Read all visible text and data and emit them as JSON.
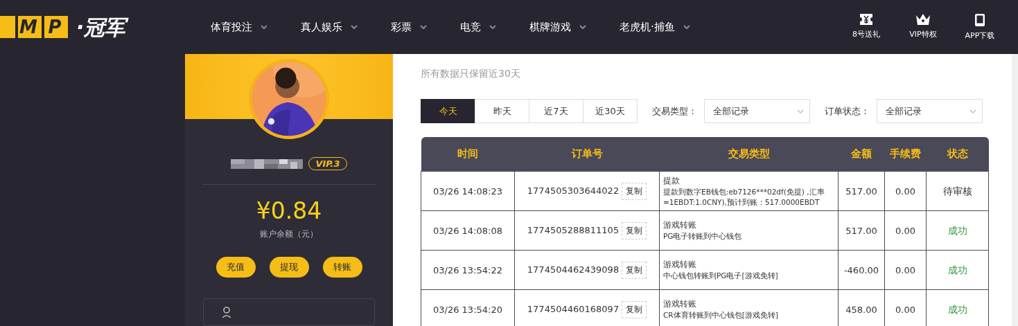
{
  "header": {
    "logo_letters": [
      "M",
      "P"
    ],
    "logo_name": "·冠军",
    "nav": [
      {
        "label": "体育投注"
      },
      {
        "label": "真人娱乐"
      },
      {
        "label": "彩票"
      },
      {
        "label": "电竞"
      },
      {
        "label": "棋牌游戏"
      },
      {
        "label": "老虎机·捕鱼"
      }
    ],
    "shortcuts": [
      {
        "kind": "ticket",
        "label": "8号送礼"
      },
      {
        "kind": "crown",
        "label": "VIP特权"
      },
      {
        "kind": "phone",
        "label": "APP下载"
      }
    ]
  },
  "profile": {
    "vip": "VIP.3",
    "balance": "¥0.84",
    "balance_label": "账户余额（元）",
    "actions": [
      "充值",
      "提现",
      "转账"
    ]
  },
  "content": {
    "note": "所有数据只保留近30天",
    "periods": [
      {
        "label": "今天",
        "selected": true
      },
      {
        "label": "昨天",
        "selected": false
      },
      {
        "label": "近7天",
        "selected": false
      },
      {
        "label": "近30天",
        "selected": false
      }
    ],
    "filters": [
      {
        "label": "交易类型：",
        "value": "全部记录"
      },
      {
        "label": "订单状态：",
        "value": "全部记录"
      }
    ],
    "table": {
      "columns": [
        "时间",
        "订单号",
        "交易类型",
        "金额",
        "手续费",
        "状态"
      ],
      "rows": [
        {
          "time": "03/26 14:08:23",
          "order": "1774505303644022",
          "type": "提款",
          "detail": "提款到数字EB钱包:eb7126***02df(免提) ,汇率=1EBDT:1.0CNY),预计到账：517.0000EBDT",
          "amount": "517.00",
          "fee": "0.00",
          "status": "待审核",
          "color": "#333333",
          "copy": "复制"
        },
        {
          "time": "03/26 14:08:08",
          "order": "1774505288811105",
          "type": "游戏转账",
          "detail": "PG电子转账到中心钱包",
          "amount": "517.00",
          "fee": "0.00",
          "status": "成功",
          "color": "#2f9a3a",
          "copy": "复制"
        },
        {
          "time": "03/26 13:54:22",
          "order": "1774504462439098",
          "type": "游戏转账",
          "detail": "中心钱包转账到PG电子[游戏免转]",
          "amount": "-460.00",
          "fee": "0.00",
          "status": "成功",
          "color": "#2f9a3a",
          "copy": "复制"
        },
        {
          "time": "03/26 13:54:20",
          "order": "1774504460168097",
          "type": "游戏转账",
          "detail": "CR体育转账到中心钱包[游戏免转]",
          "amount": "458.00",
          "fee": "0.00",
          "status": "成功",
          "color": "#2f9a3a",
          "copy": "复制"
        }
      ]
    }
  }
}
